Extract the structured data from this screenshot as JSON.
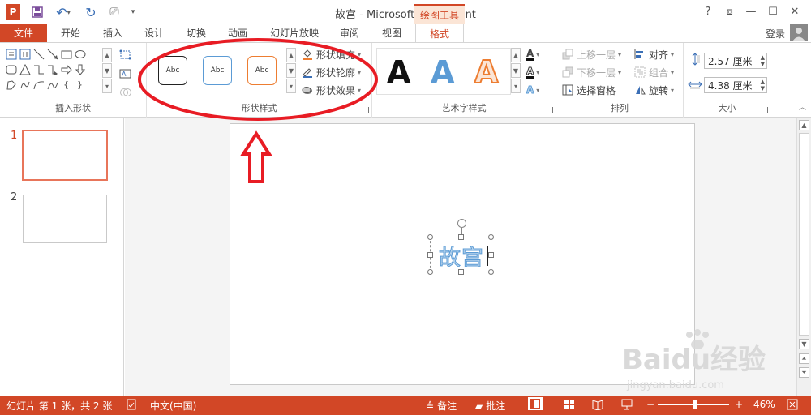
{
  "window": {
    "title": "故宫 - Microsoft PowerPoint",
    "contextual_group": "绘图工具",
    "controls": {
      "help": "?",
      "ribbon_display": "⧈",
      "minimize": "—",
      "restore": "☐",
      "close": "✕"
    }
  },
  "quick_access": {
    "app_icon": "P",
    "save": "💾",
    "undo": "↶",
    "redo": "↻",
    "present": "⎚",
    "customize": "▾"
  },
  "tabs": {
    "file": "文件",
    "items": [
      "开始",
      "插入",
      "设计",
      "切换",
      "动画",
      "幻灯片放映",
      "审阅",
      "视图",
      "格式"
    ],
    "active": "格式"
  },
  "account": {
    "login": "登录"
  },
  "ribbon": {
    "groups": {
      "insert_shapes": "插入形状",
      "shape_styles": "形状样式",
      "wordart_styles": "艺术字样式",
      "arrange": "排列",
      "size": "大小"
    },
    "shape_styles": {
      "thumbs": [
        "Abc",
        "Abc",
        "Abc"
      ],
      "fill": "形状填充",
      "outline": "形状轮廓",
      "effects": "形状效果"
    },
    "wordart": {
      "letters": [
        "A",
        "A",
        "A"
      ],
      "text_fill_icon": "A",
      "text_outline_icon": "A",
      "text_effects_icon": "A"
    },
    "arrange": {
      "bring_forward": "上移一层",
      "send_backward": "下移一层",
      "selection_pane": "选择窗格",
      "align": "对齐",
      "group": "组合",
      "rotate": "旋转"
    },
    "size": {
      "height": "2.57 厘米",
      "width": "4.38 厘米"
    }
  },
  "slides": {
    "numbers": [
      "1",
      "2"
    ],
    "selected": 1
  },
  "slide_content": {
    "text": "故宫"
  },
  "status": {
    "slide_info": "幻灯片 第 1 张，共 2 张",
    "language": "中文(中国)",
    "notes": "备注",
    "comments": "批注",
    "zoom_minus": "−",
    "zoom_plus": "+",
    "zoom": "46%"
  },
  "watermark": {
    "brand": "Baidu经验",
    "url": "jingyan.baidu.com"
  },
  "colors": {
    "accent": "#d24726",
    "annotation": "#e81c24",
    "wordart_blue": "#5b9bd5",
    "wordart_orange": "#ed7d31"
  }
}
